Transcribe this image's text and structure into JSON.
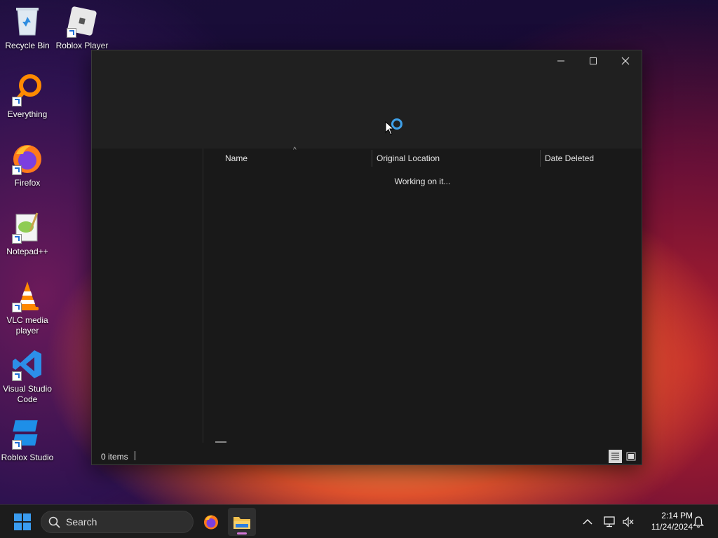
{
  "desktop": {
    "icons": [
      {
        "label": "Recycle Bin"
      },
      {
        "label": "Roblox Player"
      },
      {
        "label": "Everything"
      },
      {
        "label": "Firefox"
      },
      {
        "label": "Notepad++"
      },
      {
        "label": "VLC media player"
      },
      {
        "label": "Visual Studio Code"
      },
      {
        "label": "Roblox Studio"
      }
    ]
  },
  "window": {
    "columns": [
      {
        "label": "Name"
      },
      {
        "label": "Original Location"
      },
      {
        "label": "Date Deleted"
      }
    ],
    "loading_text": "Working on it...",
    "status": {
      "items_label": "0 items"
    }
  },
  "taskbar": {
    "search_label": "Search",
    "clock": {
      "time": "2:14 PM",
      "date": "11/24/2024"
    }
  },
  "colors": {
    "accent": "#3fa0e8",
    "window_bg": "#191919",
    "taskbar_bg": "#1c1c1c"
  }
}
